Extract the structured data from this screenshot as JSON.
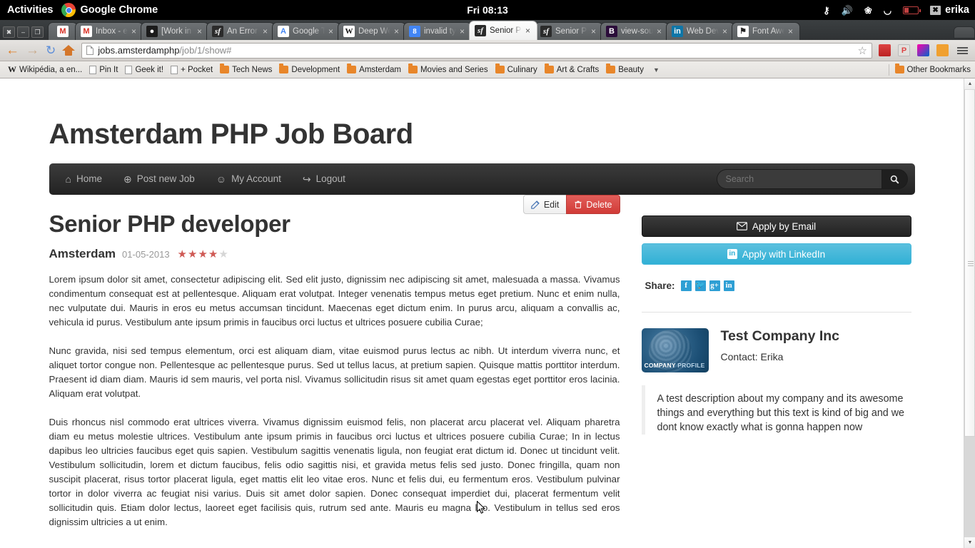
{
  "desktop": {
    "activities": "Activities",
    "app_name": "Google Chrome",
    "clock": "Fri 08:13",
    "user": "erika",
    "tray_icons": [
      "accessibility-icon",
      "volume-icon",
      "bluetooth-icon",
      "wifi-icon",
      "battery-icon",
      "messages-icon"
    ]
  },
  "browser": {
    "window_buttons": [
      "close",
      "minimize",
      "restore"
    ],
    "tabs": [
      {
        "label": "",
        "favicon": "gmail-icon",
        "pinned": true,
        "active": false
      },
      {
        "label": "Inbox - eri",
        "favicon": "gmail-icon",
        "pinned": false,
        "active": false
      },
      {
        "label": "[Work in P",
        "favicon": "github-icon",
        "pinned": false,
        "active": false
      },
      {
        "label": "An Error O",
        "favicon": "symfony-icon",
        "pinned": false,
        "active": false
      },
      {
        "label": "Google Tr",
        "favicon": "google-translate-icon",
        "pinned": false,
        "active": false
      },
      {
        "label": "Deep Web",
        "favicon": "wikipedia-icon",
        "pinned": false,
        "active": false
      },
      {
        "label": "invalid typ",
        "favicon": "google-icon",
        "pinned": false,
        "active": false
      },
      {
        "label": "Senior PH",
        "favicon": "symfony-icon",
        "pinned": false,
        "active": true
      },
      {
        "label": "Senior PH",
        "favicon": "symfony-icon",
        "pinned": false,
        "active": false
      },
      {
        "label": "view-sour",
        "favicon": "bitbucket-icon",
        "pinned": false,
        "active": false
      },
      {
        "label": "Web Deve",
        "favicon": "linkedin-icon",
        "pinned": false,
        "active": false
      },
      {
        "label": "Font Awe",
        "favicon": "flag-icon",
        "pinned": false,
        "active": false
      }
    ],
    "toolbar": {
      "back": "back-arrow-icon",
      "forward": "forward-arrow-icon",
      "reload": "reload-icon",
      "home": "home-icon",
      "url_main": "jobs.amsterdamphp",
      "url_path": "/job/1/show#",
      "bookmark_star": "star-icon",
      "menu": "hamburger-menu-icon"
    },
    "bookmarks": [
      {
        "label": "Wikipédia, a en...",
        "icon": "wikipedia-icon"
      },
      {
        "label": "Pin It",
        "icon": "page-icon"
      },
      {
        "label": "Geek it!",
        "icon": "page-icon"
      },
      {
        "label": "+ Pocket",
        "icon": "page-icon"
      },
      {
        "label": "Tech News",
        "icon": "folder-icon"
      },
      {
        "label": "Development",
        "icon": "folder-icon"
      },
      {
        "label": "Amsterdam",
        "icon": "folder-icon"
      },
      {
        "label": "Movies and Series",
        "icon": "folder-icon"
      },
      {
        "label": "Culinary",
        "icon": "folder-icon"
      },
      {
        "label": "Art & Crafts",
        "icon": "folder-icon"
      },
      {
        "label": "Beauty",
        "icon": "folder-icon"
      }
    ],
    "bookmarks_overflow": "▼",
    "other_bookmarks": "Other Bookmarks"
  },
  "site": {
    "title": "Amsterdam PHP Job Board",
    "nav": [
      {
        "label": "Home",
        "icon": "home-icon"
      },
      {
        "label": "Post new Job",
        "icon": "plus-circle-icon"
      },
      {
        "label": "My Account",
        "icon": "user-icon"
      },
      {
        "label": "Logout",
        "icon": "sign-out-icon"
      }
    ],
    "search": {
      "placeholder": "Search",
      "value": "",
      "button_icon": "search-icon"
    }
  },
  "job": {
    "title": "Senior PHP developer",
    "location": "Amsterdam",
    "date": "01-05-2013",
    "rating": 4,
    "rating_max": 5,
    "edit_label": "Edit",
    "delete_label": "Delete",
    "paragraphs": [
      "Lorem ipsum dolor sit amet, consectetur adipiscing elit. Sed elit justo, dignissim nec adipiscing sit amet, malesuada a massa. Vivamus condimentum consequat est at pellentesque. Aliquam erat volutpat. Integer venenatis tempus metus eget pretium. Nunc et enim nulla, nec vulputate dui. Mauris in eros eu metus accumsan tincidunt. Maecenas eget dictum enim. In purus arcu, aliquam a convallis ac, vehicula id purus. Vestibulum ante ipsum primis in faucibus orci luctus et ultrices posuere cubilia Curae;",
      "Nunc gravida, nisi sed tempus elementum, orci est aliquam diam, vitae euismod purus lectus ac nibh. Ut interdum viverra nunc, et aliquet tortor congue non. Pellentesque ac pellentesque purus. Sed ut tellus lacus, at pretium sapien. Quisque mattis porttitor interdum. Praesent id diam diam. Mauris id sem mauris, vel porta nisl. Vivamus sollicitudin risus sit amet quam egestas eget porttitor eros lacinia. Aliquam erat volutpat.",
      "Duis rhoncus nisl commodo erat ultrices viverra. Vivamus dignissim euismod felis, non placerat arcu placerat vel. Aliquam pharetra diam eu metus molestie ultrices. Vestibulum ante ipsum primis in faucibus orci luctus et ultrices posuere cubilia Curae; In in lectus dapibus leo ultricies faucibus eget quis sapien. Vestibulum sagittis venenatis ligula, non feugiat erat dictum id. Donec ut tincidunt velit. Vestibulum sollicitudin, lorem et dictum faucibus, felis odio sagittis nisi, et gravida metus felis sed justo. Donec fringilla, quam non suscipit placerat, risus tortor placerat ligula, eget mattis elit leo vitae eros. Nunc et felis dui, eu fermentum eros. Vestibulum pulvinar tortor in dolor viverra ac feugiat nisi varius. Duis sit amet dolor sapien. Donec consequat imperdiet dui, placerat fermentum velit sollicitudin quis. Etiam dolor lectus, laoreet eget facilisis quis, rutrum sed ante. Mauris eu magna leo. Vestibulum in tellus sed eros dignissim ultricies a ut enim."
    ]
  },
  "sidebar": {
    "apply_email": "Apply by Email",
    "apply_email_icon": "envelope-icon",
    "apply_linkedin": "Apply with LinkedIn",
    "apply_linkedin_icon": "linkedin-icon",
    "share_label": "Share:",
    "share_icons": [
      "facebook-icon",
      "twitter-icon",
      "google-plus-icon",
      "linkedin-icon"
    ],
    "company": {
      "name": "Test Company Inc",
      "contact": "Contact: Erika",
      "logo_caption_bold": "COMPANY",
      "logo_caption_light": "PROFILE",
      "description": "A test description about my company and its awesome things and everything but this text is kind of big and we dont know exactly what is gonna happen now"
    }
  },
  "colors": {
    "brand_dark": "#222222",
    "linkedin_blue": "#31b0d5",
    "delete_red": "#d13b37",
    "star_on": "#cf5a55",
    "star_off": "#d6d6d6",
    "share_blue": "#2e9fd4"
  }
}
